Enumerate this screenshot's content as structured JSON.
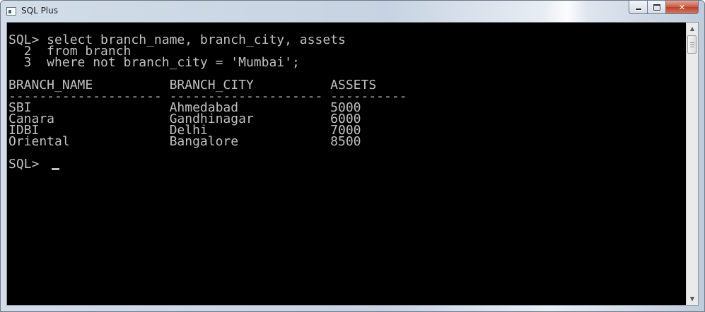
{
  "window": {
    "title": "SQL Plus",
    "controls": {
      "minimize": "minimize",
      "maximize": "maximize",
      "close": "✕"
    }
  },
  "console": {
    "lines": [
      "SQL> select branch_name, branch_city, assets",
      "  2  from branch",
      "  3  where not branch_city = 'Mumbai';",
      "",
      "BRANCH_NAME          BRANCH_CITY          ASSETS",
      "-------------------- -------------------- ----------",
      "SBI                  Ahmedabad            5000",
      "Canara               Gandhinagar          6000",
      "IDBI                 Delhi                7000",
      "Oriental             Bangalore            8500",
      "",
      "SQL> "
    ]
  },
  "icons": {
    "app": "console-window-icon",
    "scroll_up": "scroll-up-arrow-icon",
    "scroll_down": "scroll-down-arrow-icon"
  }
}
